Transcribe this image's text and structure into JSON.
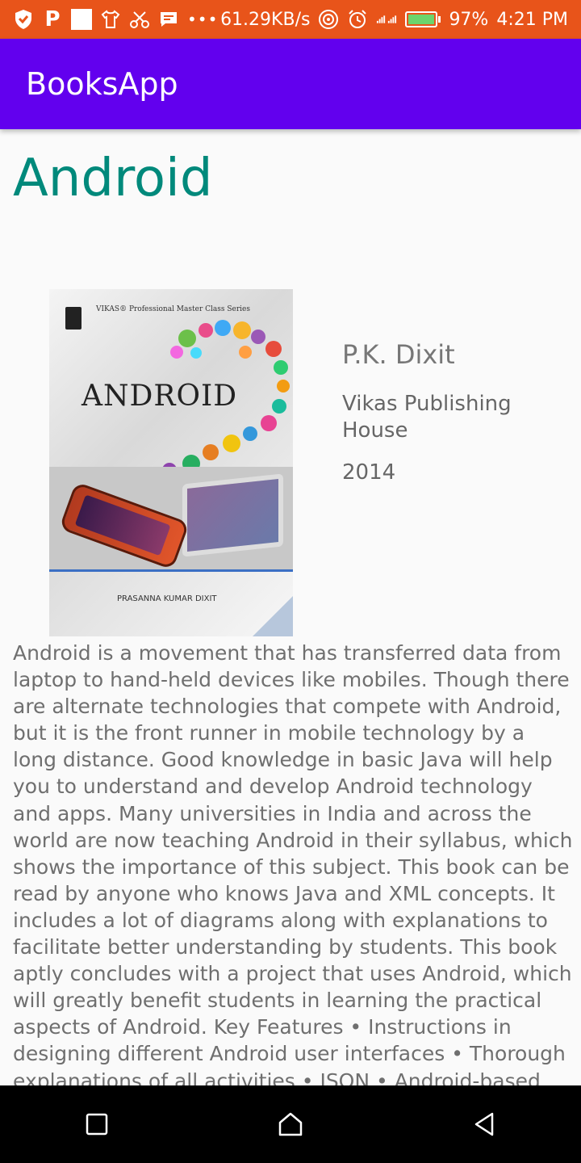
{
  "status_bar": {
    "network_speed": "61.29KB/s",
    "battery": "97%",
    "time": "4:21 PM",
    "bg_color": "#e8541a"
  },
  "app_bar": {
    "title": "BooksApp",
    "bg_color": "#6200ee"
  },
  "book": {
    "title": "Android",
    "author": "P.K. Dixit",
    "publisher": "Vikas Publishing House",
    "year": "2014",
    "cover": {
      "series_text": "VIKAS® Professional Master Class Series",
      "title": "ANDROID",
      "author": "PRASANNA KUMAR DIXIT"
    },
    "description": "Android is a movement that has transferred data from laptop to hand-held devices like mobiles. Though there are alternate technologies that compete with Android, but it is the front runner in mobile technology by a long distance. Good knowledge in basic Java will help you to understand and develop Android technology and apps. Many universities in India and across the world are now teaching Android in their syllabus, which shows the importance of this subject. This book can be read by anyone who knows Java and XML concepts. It includes a lot of diagrams along with explanations to facilitate better understanding by students. This book aptly concludes with a project that uses Android, which will greatly benefit students in learning the practical aspects of Android. Key Features • Instructions in designing different Android user interfaces • Thorough explanations of all activities • JSON • Android-based",
    "title_color": "#00897b"
  },
  "nav_bar": {
    "icons": [
      "recents-icon",
      "home-icon",
      "back-icon"
    ]
  }
}
